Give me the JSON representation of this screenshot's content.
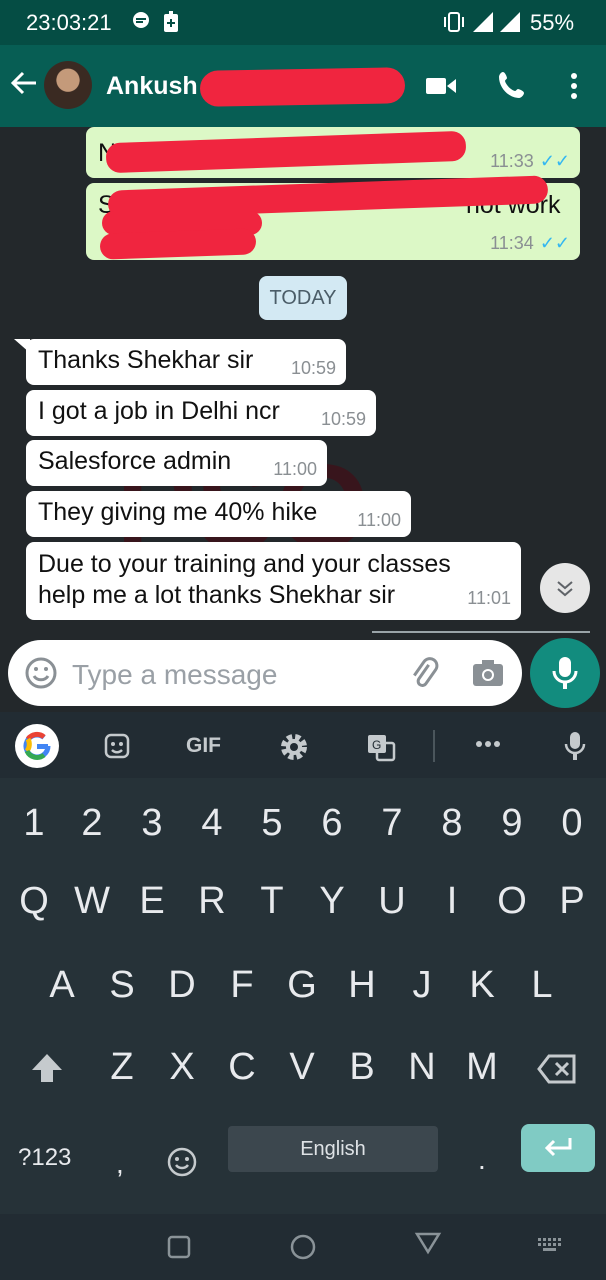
{
  "status_bar": {
    "time": "23:03:21",
    "battery": "55%"
  },
  "header": {
    "contact_name": "Ankush"
  },
  "messages": {
    "out1_time": "11:33",
    "out2_text_visible": "So te",
    "out2_text_end": "not work",
    "out2_time": "11:34",
    "date_chip": "TODAY",
    "m1": {
      "text": "Thanks Shekhar sir",
      "time": "10:59"
    },
    "m2": {
      "text": "I got a job in Delhi ncr",
      "time": "10:59"
    },
    "m3": {
      "text": "Salesforce admin",
      "time": "11:00"
    },
    "m4": {
      "text": "They giving me 40% hike",
      "time": "11:00"
    },
    "m5": {
      "text": "Due to your training and your classes help me a lot thanks Shekhar sir",
      "time": "11:01"
    }
  },
  "composer": {
    "placeholder": "Type a message"
  },
  "keyboard": {
    "toolbar": {
      "gif": "GIF"
    },
    "row_numbers": [
      "1",
      "2",
      "3",
      "4",
      "5",
      "6",
      "7",
      "8",
      "9",
      "0"
    ],
    "row_q": [
      "Q",
      "W",
      "E",
      "R",
      "T",
      "Y",
      "U",
      "I",
      "O",
      "P"
    ],
    "row_a": [
      "A",
      "S",
      "D",
      "F",
      "G",
      "H",
      "J",
      "K",
      "L"
    ],
    "row_z": [
      "Z",
      "X",
      "C",
      "V",
      "B",
      "N",
      "M"
    ],
    "symbols": "?123",
    "comma": ",",
    "space_label": "English",
    "period": "."
  },
  "icons": [
    "back-arrow-icon",
    "video-call-icon",
    "phone-icon",
    "more-icon",
    "emoji-icon",
    "attach-icon",
    "camera-icon",
    "mic-icon",
    "scroll-down-icon",
    "google-icon",
    "sticker-icon",
    "settings-icon",
    "translate-icon",
    "shift-icon",
    "backspace-icon",
    "enter-icon",
    "nav-recents-icon",
    "nav-home-icon",
    "nav-back-icon",
    "keyboard-hide-icon"
  ],
  "colors": {
    "header": "#075e54",
    "outgoing_bubble": "#dcf8c6",
    "incoming_bubble": "#ffffff",
    "fab": "#128c7e",
    "redaction": "#f0253f"
  }
}
